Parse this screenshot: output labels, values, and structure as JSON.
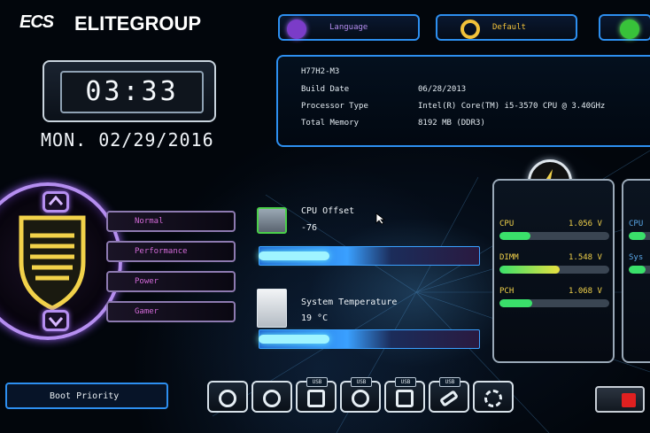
{
  "brand": {
    "mark": "ECS",
    "name": "ELITEGROUP"
  },
  "topbar": {
    "language_label": "Language",
    "default_label": "Default"
  },
  "clock": {
    "time": "03:33",
    "date": "MON. 02/29/2016"
  },
  "system_info": {
    "model": "H77H2-M3",
    "rows": [
      {
        "label": "Build Date",
        "value": "06/28/2013"
      },
      {
        "label": "Processor Type",
        "value": "Intel(R) Core(TM) i5-3570 CPU @ 3.40GHz"
      },
      {
        "label": "Total Memory",
        "value": "8192 MB (DDR3)"
      }
    ]
  },
  "modes": [
    "Normal",
    "Performance",
    "Power",
    "Gamer"
  ],
  "cpu_offset": {
    "label": "CPU Offset",
    "value": "-76"
  },
  "system_temperature": {
    "label": "System Temperature",
    "value": "19 °C"
  },
  "voltages": [
    {
      "label": "CPU",
      "value": "1.056 V",
      "level": 0.28
    },
    {
      "label": "DIMM",
      "value": "1.548 V",
      "level": 0.55
    },
    {
      "label": "PCH",
      "value": "1.068 V",
      "level": 0.3
    }
  ],
  "voltages_partial": [
    "CPU",
    "Sys"
  ],
  "boot": {
    "label": "Boot Priority",
    "devices": [
      {
        "icon": "hdd-icon",
        "tag": ""
      },
      {
        "icon": "optical-disc-icon",
        "tag": ""
      },
      {
        "icon": "usb-hdd-icon",
        "tag": "USB"
      },
      {
        "icon": "usb-disc-icon",
        "tag": "USB"
      },
      {
        "icon": "usb-hdd-icon",
        "tag": "USB"
      },
      {
        "icon": "usb-stick-icon",
        "tag": "USB"
      },
      {
        "icon": "network-icon",
        "tag": ""
      }
    ]
  },
  "colors": {
    "accent": "#2d8ff0",
    "purple": "#b58ef0",
    "yellow": "#f2d24a",
    "mode_text": "#d36ad8"
  }
}
